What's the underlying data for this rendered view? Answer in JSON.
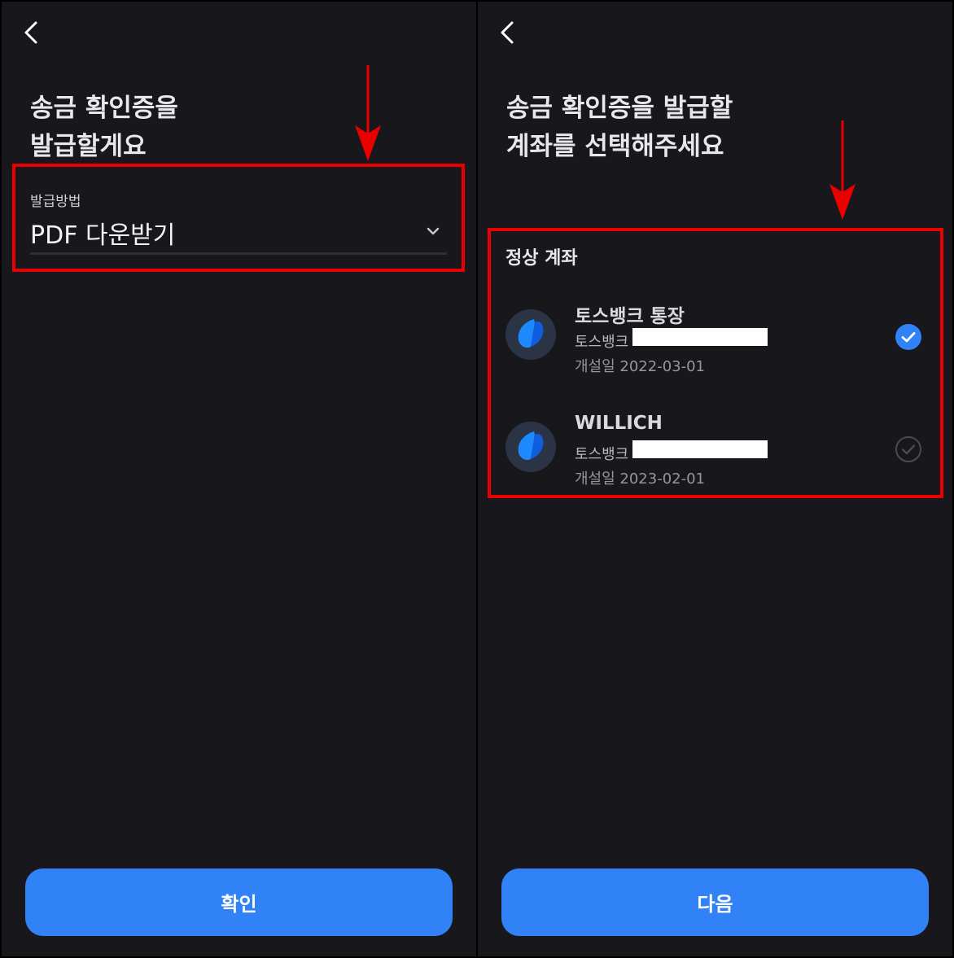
{
  "left": {
    "title_lines": [
      "송금 확인증을",
      "발급할게요"
    ],
    "method_label": "발급방법",
    "method_value": "PDF 다운받기",
    "confirm_button": "확인"
  },
  "right": {
    "title_lines": [
      "송금 확인증을 발급할",
      "계좌를 선택해주세요"
    ],
    "section_title": "정상 계좌",
    "accounts": [
      {
        "name": "토스뱅크 통장",
        "bank": "토스뱅크",
        "opened": "개설일 2022-03-01",
        "selected": true
      },
      {
        "name": "WILLICH",
        "bank": "토스뱅크",
        "opened": "개설일 2023-02-01",
        "selected": false
      }
    ],
    "next_button": "다음"
  },
  "icons": {
    "back": "chevron-left-icon",
    "dropdown": "chevron-down-icon",
    "bank_logo": "toss-bank-logo-icon",
    "selected": "check-circle-filled-icon",
    "unselected": "check-circle-outline-icon"
  },
  "colors": {
    "background": "#17171c",
    "primary": "#3182f6",
    "highlight": "#ea0000",
    "text": "#e8e8ea"
  }
}
